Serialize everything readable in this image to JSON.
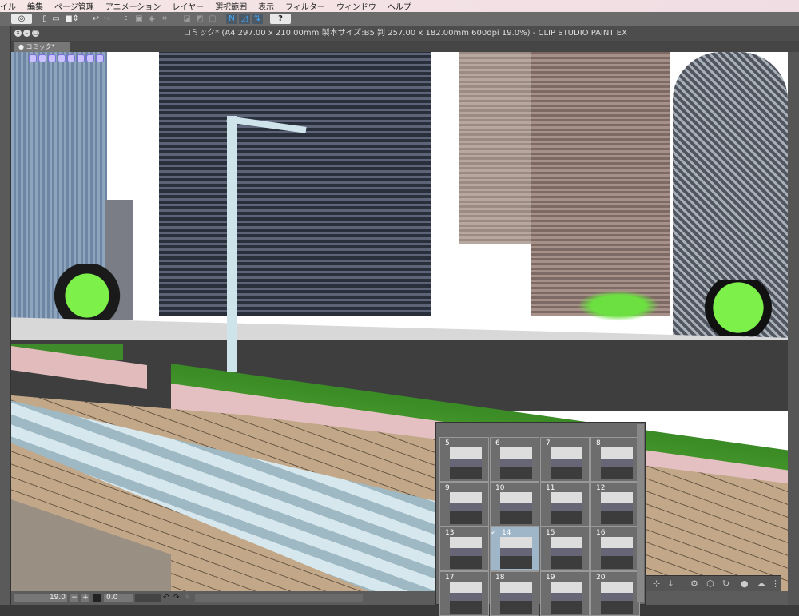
{
  "menu": [
    "イル",
    "編集",
    "ページ管理",
    "アニメーション",
    "レイヤー",
    "選択範囲",
    "表示",
    "フィルター",
    "ウィンドウ",
    "ヘルプ"
  ],
  "window": {
    "title": "コミック* (A4 297.00 x 210.00mm 製本サイズ:B5 判 257.00 x 182.00mm 600dpi 19.0%)  - CLIP STUDIO PAINT EX",
    "tab": "● コミック*"
  },
  "toolbar": {
    "help": "?"
  },
  "status": {
    "zoom": "19.0",
    "rotation": "0.0"
  },
  "thumbnails": {
    "selected": "14",
    "check": "✓",
    "pages": [
      "5",
      "6",
      "7",
      "8",
      "9",
      "10",
      "11",
      "12",
      "13",
      "14",
      "15",
      "16",
      "17",
      "18",
      "19",
      "20"
    ]
  }
}
